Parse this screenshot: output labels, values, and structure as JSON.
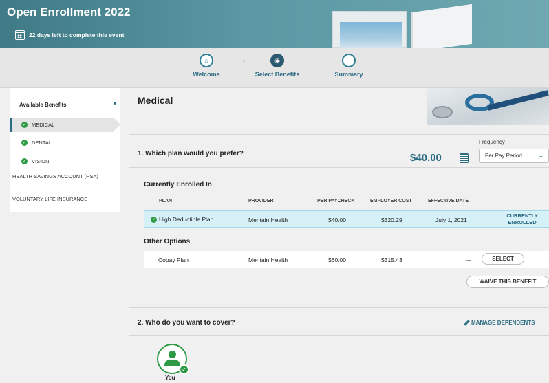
{
  "header": {
    "title": "Open Enrollment 2022",
    "subtitle": "22 days left to complete this event"
  },
  "stepper": {
    "steps": [
      {
        "label": "Welcome",
        "icon": "home-icon",
        "state": "complete"
      },
      {
        "label": "Select Benefits",
        "icon": "eye-icon",
        "state": "active"
      },
      {
        "label": "Summary",
        "icon": "",
        "state": "upcoming"
      }
    ]
  },
  "sidebar": {
    "heading": "Available Benefits",
    "items": [
      {
        "label": "MEDICAL",
        "checked": true,
        "active": true
      },
      {
        "label": "DENTAL",
        "checked": true
      },
      {
        "label": "VISION",
        "checked": true
      },
      {
        "label": "HEALTH SAVINGS ACCOUNT (HSA)"
      },
      {
        "label": "VOLUNTARY LIFE INSURANCE"
      }
    ]
  },
  "main": {
    "title": "Medical",
    "question1": "1. Which plan would you prefer?",
    "price": "$40.00",
    "frequency": {
      "label": "Frequency",
      "value": "Per Pay Period"
    },
    "current_heading": "Currently Enrolled In",
    "columns": [
      "PLAN",
      "PROVIDER",
      "PER PAYCHECK",
      "EMPLOYER COST",
      "EFFECTIVE DATE"
    ],
    "current_row": {
      "plan": "High Deductible Plan",
      "provider": "Meritain Health",
      "per_paycheck": "$40.00",
      "employer_cost": "$320.29",
      "effective_date": "July 1, 2021",
      "status": "CURRENTLY ENROLLED"
    },
    "other_heading": "Other Options",
    "other_row": {
      "plan": "Copay Plan",
      "provider": "Meritain Health",
      "per_paycheck": "$60.00",
      "employer_cost": "$315.43",
      "effective_date": "---",
      "action": "SELECT"
    },
    "waive_label": "WAIVE THIS BENEFIT",
    "question2": "2. Who do you want to cover?",
    "manage_label": "MANAGE DEPENDENTS",
    "dependent": {
      "label": "You"
    }
  },
  "colors": {
    "accent": "#2c6b82",
    "success": "#2e9a44",
    "highlight_row": "#d6f0f7"
  }
}
